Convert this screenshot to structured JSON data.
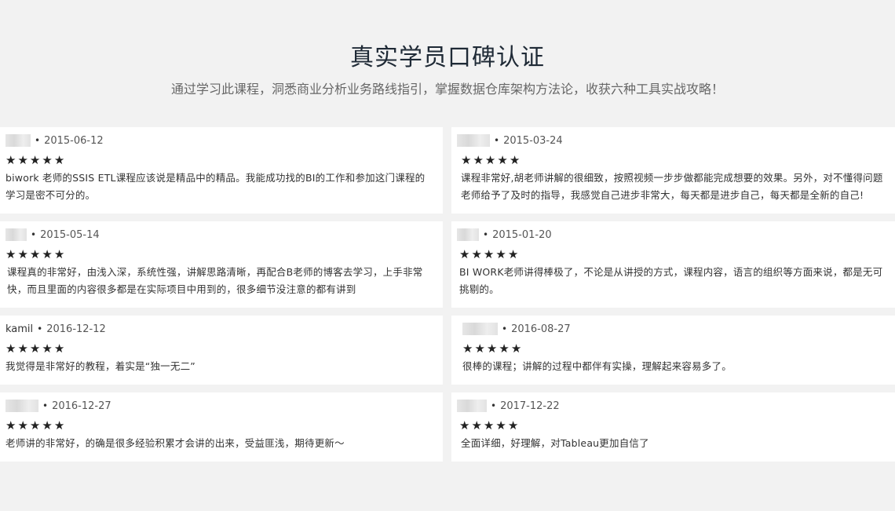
{
  "section": {
    "title": "真实学员口碑认证",
    "subtitle": "通过学习此课程，洞悉商业分析业务路线指引，掌握数据仓库架构方法论，收获六种工具实战攻略！"
  },
  "reviews": [
    {
      "user": "",
      "date": "2015-06-12",
      "rating": 5,
      "comment": "biwork 老师的SSIS ETL课程应该说是精品中的精品。我能成功找的BI的工作和参加这门课程的学习是密不可分的。"
    },
    {
      "user": "",
      "date": "2015-03-24",
      "rating": 5,
      "comment": "课程非常好,胡老师讲解的很细致，按照视频一步步做都能完成想要的效果。另外，对不懂得问题老师给予了及时的指导，我感觉自己进步非常大，每天都是进步自己，每天都是全新的自己!"
    },
    {
      "user": "",
      "date": "2015-05-14",
      "rating": 5,
      "comment": "课程真的非常好，由浅入深，系统性强，讲解思路清晰，再配合B老师的博客去学习，上手非常快，而且里面的内容很多都是在实际项目中用到的，很多细节没注意的都有讲到"
    },
    {
      "user": "",
      "date": "2015-01-20",
      "rating": 5,
      "comment": "BI WORK老师讲得棒极了，不论是从讲授的方式，课程内容，语言的组织等方面来说，都是无可挑剔的。"
    },
    {
      "user": "kamil",
      "date": "2016-12-12",
      "rating": 5,
      "comment": "我觉得是非常好的教程，着实是“独一无二”"
    },
    {
      "user": "",
      "date": "2016-08-27",
      "rating": 5,
      "comment": "很棒的课程；讲解的过程中都伴有实操，理解起来容易多了。"
    },
    {
      "user": "",
      "date": "2016-12-27",
      "rating": 5,
      "comment": "老师讲的非常好，的确是很多经验积累才会讲的出来，受益匪浅，期待更新～"
    },
    {
      "user": "",
      "date": "2017-12-22",
      "rating": 5,
      "comment": "全面详细，好理解，对Tableau更加自信了"
    }
  ],
  "icons": {
    "star": "star-icon",
    "separator": "•"
  },
  "colors": {
    "background": "#f2f2f2",
    "card": "#ffffff",
    "title": "#1f2a36",
    "star": "#222222"
  }
}
